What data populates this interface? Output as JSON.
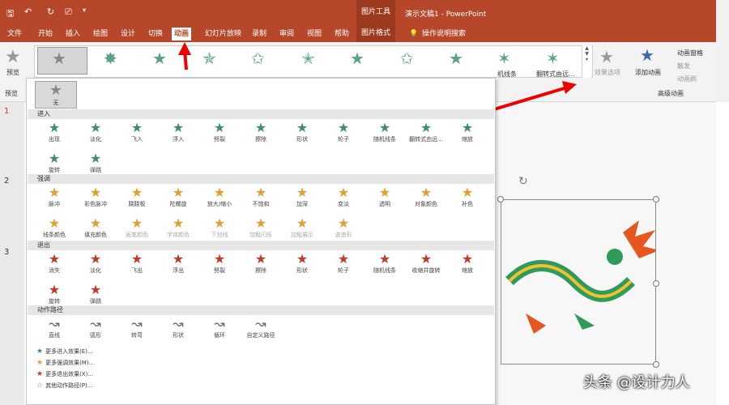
{
  "app": {
    "doc_title": "演示文稿1 - PowerPoint",
    "context_tools": "图片工具"
  },
  "qat": {
    "save": "🖫",
    "undo": "↶",
    "redo": "↻",
    "present": "⎚",
    "more": "▾"
  },
  "tabs": [
    "文件",
    "开始",
    "插入",
    "绘图",
    "设计",
    "切换",
    "动画",
    "幻灯片放映",
    "录制",
    "审阅",
    "视图",
    "帮助"
  ],
  "ctx_tab": "图片格式",
  "tell_me": "操作说明搜索",
  "ribbon": {
    "preview_label": "预览",
    "preview_group": "预览",
    "gallery_label_1": "机线条",
    "gallery_label_2": "翻转式由远...",
    "effect_options": "效果选项",
    "add_animation": "添加动画",
    "anim_pane": "动画窗格",
    "trigger": "触发",
    "anim_painter": "动画刷",
    "advanced_group": "高级动画"
  },
  "dropdown": {
    "none_label": "无",
    "sections": {
      "entrance": {
        "title": "进入",
        "items": [
          "出现",
          "淡化",
          "飞入",
          "浮入",
          "劈裂",
          "擦除",
          "形状",
          "轮子",
          "随机线条",
          "翻转式由远...",
          "缩放",
          "旋转",
          "弹跳"
        ]
      },
      "emphasis": {
        "title": "强调",
        "items": [
          "脉冲",
          "彩色脉冲",
          "跷跷板",
          "陀螺旋",
          "放大/缩小",
          "不饱和",
          "加深",
          "变淡",
          "透明",
          "对象颜色",
          "补色",
          "线条颜色",
          "填充颜色",
          "画笔颜色",
          "字体颜色",
          "下划线",
          "加粗闪烁",
          "加粗展示",
          "波浪形"
        ]
      },
      "exit": {
        "title": "退出",
        "items": [
          "消失",
          "淡化",
          "飞出",
          "浮出",
          "劈裂",
          "擦除",
          "形状",
          "轮子",
          "随机线条",
          "收缩并旋转",
          "缩放",
          "旋转",
          "弹跳"
        ]
      },
      "paths": {
        "title": "动作路径",
        "items": [
          "直线",
          "弧形",
          "转弯",
          "形状",
          "循环",
          "自定义路径"
        ]
      }
    },
    "more": [
      "更多进入效果(E)...",
      "更多强调效果(M)...",
      "更多退出效果(X)...",
      "其他动作路径(P)..."
    ]
  },
  "slides": [
    "1",
    "2",
    "3"
  ],
  "watermark": "头条 @设计力人",
  "watermark2": "设计力人",
  "colors": {
    "accent": "#b7472a",
    "entrance": "#3e8e6e",
    "emphasis": "#e0a030",
    "exit": "#c0392b"
  }
}
